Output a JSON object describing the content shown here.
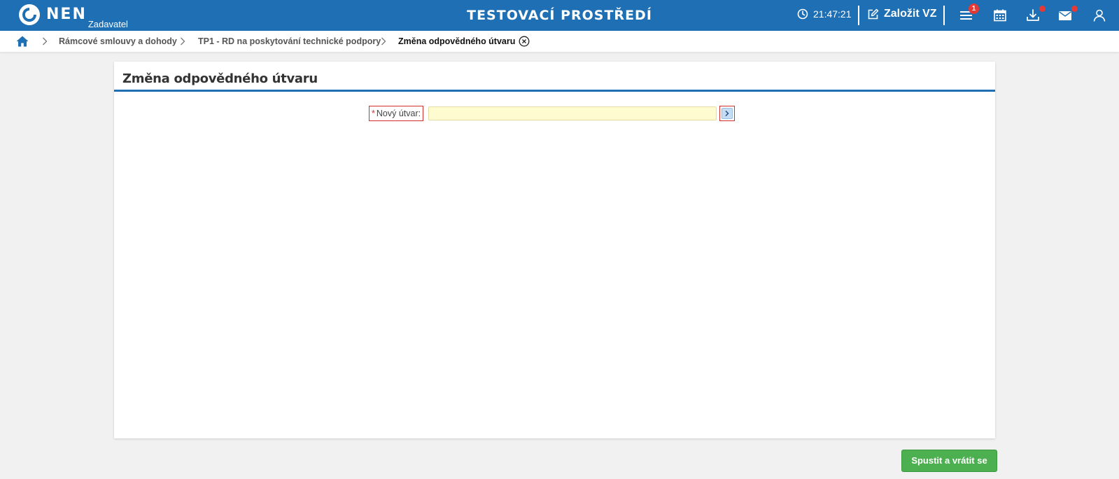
{
  "header": {
    "logo_text": "NEN",
    "logo_subtext": "Zadavatel",
    "environment_title": "TESTOVACÍ PROSTŘEDÍ",
    "clock_time": "21:47:21",
    "create_label": "Založit VZ",
    "menu_badge_count": "1",
    "colors": {
      "bar": "#1e6fb3",
      "badge": "#e53935"
    },
    "icons": [
      "clock-icon",
      "edit-icon",
      "menu-icon",
      "calendar-icon",
      "download-icon",
      "mail-icon",
      "user-icon"
    ]
  },
  "breadcrumb": {
    "items": [
      {
        "label": "Rámcové smlouvy a dohody"
      },
      {
        "label": "TP1 - RD na poskytování technické podpory"
      },
      {
        "label": "Změna odpovědného útvaru"
      }
    ]
  },
  "panel": {
    "title": "Změna odpovědného útvaru",
    "form": {
      "required_marker": "*",
      "field_label": "Nový útvar:",
      "field_value": "",
      "field_placeholder": ""
    }
  },
  "actions": {
    "run_label": "Spustit a vrátit se",
    "color": "#4caf50"
  }
}
